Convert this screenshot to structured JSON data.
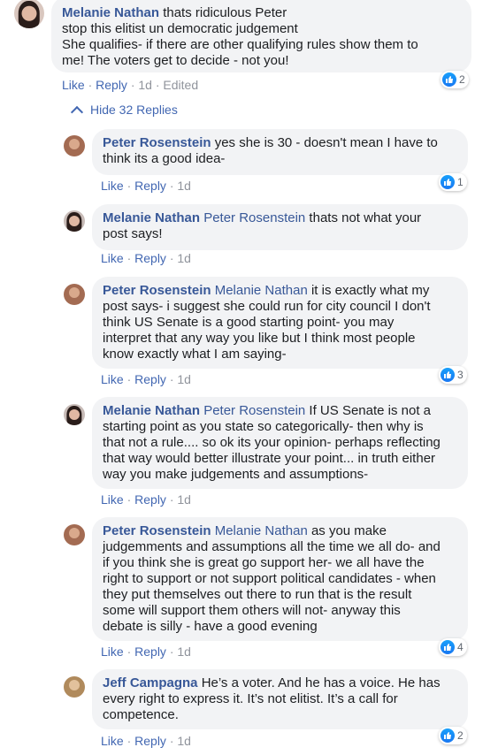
{
  "top_comment": {
    "author": "Melanie Nathan",
    "text_line1": " thats ridiculous Peter",
    "text_line2": "stop this elitist un democratic judgement",
    "text_line3": "She qualifies- if there are other qualifying rules show them to",
    "text_line4": "me! The voters get to decide - not you!",
    "like": "Like",
    "reply": "Reply",
    "time": "1d",
    "edited": "Edited",
    "reactions": "2"
  },
  "hide_replies_label": "Hide 32 Replies",
  "replies": [
    {
      "author": "Peter Rosenstein",
      "mention": "",
      "lines": [
        " yes she is 30 - doesn't mean I have to",
        "think its a good idea-"
      ],
      "like": "Like",
      "reply": "Reply",
      "time": "1d",
      "reactions": "1"
    },
    {
      "author": "Melanie Nathan",
      "mention": " Peter Rosenstein",
      "lines": [
        " thats not what your",
        "post says!"
      ],
      "like": "Like",
      "reply": "Reply",
      "time": "1d",
      "reactions": ""
    },
    {
      "author": "Peter Rosenstein",
      "mention": " Melanie Nathan",
      "lines": [
        " it is exactly what my",
        "post says- i suggest she could run for city council I don't",
        "think US Senate is a good starting point- you may",
        "interpret that any way you like but I think most people",
        "know exactly what I am saying-"
      ],
      "like": "Like",
      "reply": "Reply",
      "time": "1d",
      "reactions": "3"
    },
    {
      "author": "Melanie Nathan",
      "mention": " Peter Rosenstein",
      "lines": [
        " If US Senate is not a",
        "starting point as you state so categorically- then why is",
        "that not a rule.... so ok its your opinion- perhaps reflecting",
        "that way would better illustrate your point... in truth either",
        "way you make judgements and assumptions-"
      ],
      "like": "Like",
      "reply": "Reply",
      "time": "1d",
      "reactions": ""
    },
    {
      "author": "Peter Rosenstein",
      "mention": " Melanie Nathan",
      "lines": [
        " as you make",
        "judgemments and assumptions all the time we all do- and",
        "if you think she is great go support her- we all have the",
        "right to support or not support political candidates - when",
        "they put themselves out there to run that is the result",
        "some will support them others will not- anyway this",
        "debate is silly - have a good evening"
      ],
      "like": "Like",
      "reply": "Reply",
      "time": "1d",
      "reactions": "4"
    },
    {
      "author": "Jeff Campagna",
      "mention": "",
      "lines": [
        " He’s a voter. And he has a voice. He has",
        "every right to express it. It’s not elitist. It’s a call for",
        "competence."
      ],
      "like": "Like",
      "reply": "Reply",
      "time": "1d",
      "reactions": "2"
    }
  ],
  "colors": {
    "link": "#385898",
    "action": "#4267b2",
    "bubble": "#f2f3f5",
    "meta": "#90949c",
    "like_blue": "#1877f2"
  }
}
